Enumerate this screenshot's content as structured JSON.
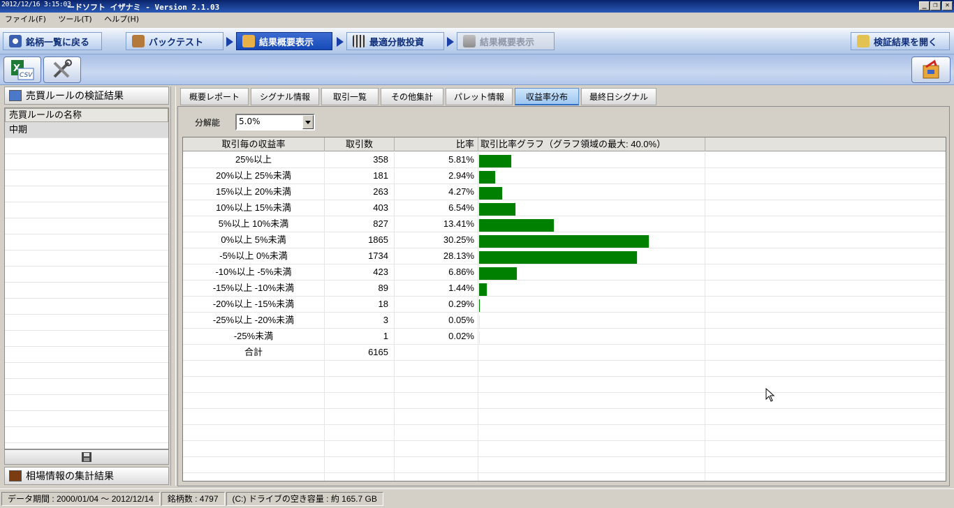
{
  "window": {
    "timestamp": "2012/12/16 3:15:03",
    "title": "ードソフト イザナミ - Version 2.1.03",
    "controls": {
      "minimize": "_",
      "restore": "❐",
      "close": "✕"
    }
  },
  "menu": [
    "ファイル(F)",
    "ツール(T)",
    "ヘルプ(H)"
  ],
  "nav": {
    "back_to_list": "銘柄一覧に戻る",
    "backtest": "バックテスト",
    "result_summary": "結果概要表示",
    "optimal_portfolio": "最適分散投資",
    "result_summary_2": "結果概要表示",
    "open_results": "検証結果を開く"
  },
  "toolbar": {
    "csv_label": "CSV"
  },
  "left_panel": {
    "header": "売買ルールの検証結果",
    "list_header": "売買ルールの名称",
    "rules": [
      "中期"
    ],
    "footer": "相場情報の集計結果"
  },
  "tabs": [
    "概要レポート",
    "シグナル情報",
    "取引一覧",
    "その他集計",
    "パレット情報",
    "収益率分布",
    "最終日シグナル"
  ],
  "active_tab": "収益率分布",
  "resolution": {
    "label": "分解能",
    "value": "5.0%"
  },
  "table": {
    "columns": [
      "取引毎の収益率",
      "取引数",
      "比率",
      "取引比率グラフ（グラフ領域の最大: 40.0%）"
    ],
    "graph_max_percent": 40.0,
    "bar_color": "#008000",
    "rows": [
      {
        "range": "25%以上",
        "count": "358",
        "ratio": "5.81%",
        "value": 5.81
      },
      {
        "range": "20%以上 25%未満",
        "count": "181",
        "ratio": "2.94%",
        "value": 2.94
      },
      {
        "range": "15%以上 20%未満",
        "count": "263",
        "ratio": "4.27%",
        "value": 4.27
      },
      {
        "range": "10%以上 15%未満",
        "count": "403",
        "ratio": "6.54%",
        "value": 6.54
      },
      {
        "range": "5%以上 10%未満",
        "count": "827",
        "ratio": "13.41%",
        "value": 13.41
      },
      {
        "range": "0%以上 5%未満",
        "count": "1865",
        "ratio": "30.25%",
        "value": 30.25
      },
      {
        "range": "-5%以上 0%未満",
        "count": "1734",
        "ratio": "28.13%",
        "value": 28.13
      },
      {
        "range": "-10%以上 -5%未満",
        "count": "423",
        "ratio": "6.86%",
        "value": 6.86
      },
      {
        "range": "-15%以上 -10%未満",
        "count": "89",
        "ratio": "1.44%",
        "value": 1.44
      },
      {
        "range": "-20%以上 -15%未満",
        "count": "18",
        "ratio": "0.29%",
        "value": 0.29
      },
      {
        "range": "-25%以上 -20%未満",
        "count": "3",
        "ratio": "0.05%",
        "value": 0.05
      },
      {
        "range": "-25%未満",
        "count": "1",
        "ratio": "0.02%",
        "value": 0.02
      }
    ],
    "total": {
      "label": "合計",
      "count": "6165"
    }
  },
  "status": {
    "data_period": "データ期間 : 2000/01/04 〜 2012/12/14",
    "stock_count": "銘柄数 : 4797",
    "disk_space": "(C:) ドライブの空き容量 : 約 165.7 GB"
  }
}
